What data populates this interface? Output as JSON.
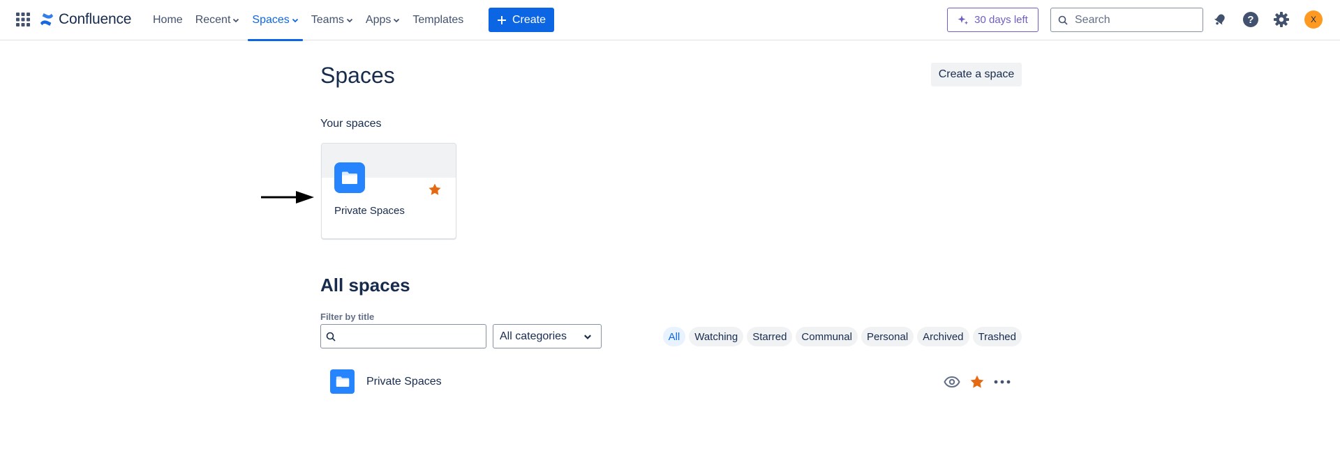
{
  "nav": {
    "logo_text": "Confluence",
    "items": [
      {
        "label": "Home",
        "dropdown": false
      },
      {
        "label": "Recent",
        "dropdown": true
      },
      {
        "label": "Spaces",
        "dropdown": true,
        "active": true
      },
      {
        "label": "Teams",
        "dropdown": true
      },
      {
        "label": "Apps",
        "dropdown": true
      },
      {
        "label": "Templates",
        "dropdown": false
      }
    ],
    "create_label": "Create",
    "trial_label": "30 days left",
    "search_placeholder": "Search",
    "avatar_initial": "X"
  },
  "page": {
    "title": "Spaces",
    "create_space_label": "Create a space",
    "your_spaces_label": "Your spaces",
    "your_spaces": [
      {
        "name": "Private Spaces",
        "starred": true
      }
    ],
    "all_spaces_title": "All spaces",
    "filter_label": "Filter by title",
    "filter_value": "",
    "category_selected": "All categories",
    "tags": [
      {
        "label": "All",
        "active": true
      },
      {
        "label": "Watching"
      },
      {
        "label": "Starred"
      },
      {
        "label": "Communal"
      },
      {
        "label": "Personal"
      },
      {
        "label": "Archived"
      },
      {
        "label": "Trashed"
      }
    ],
    "spaces": [
      {
        "name": "Private Spaces",
        "starred": true
      }
    ]
  },
  "colors": {
    "brand_blue": "#0c66e4",
    "space_icon_blue": "#2684ff",
    "star_orange": "#e56910",
    "trial_purple": "#6e5dc6",
    "avatar_orange": "#ff991f"
  }
}
